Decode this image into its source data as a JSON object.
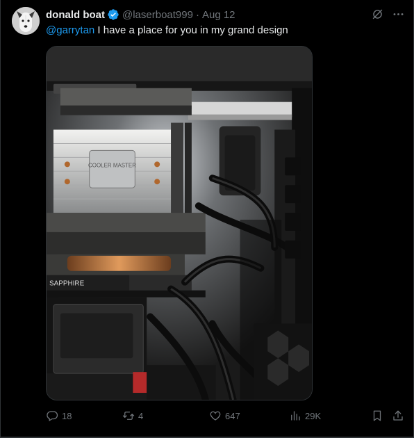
{
  "tweet": {
    "display_name": "donald boat",
    "handle": "@laserboat999",
    "separator": "·",
    "date": "Aug 12",
    "mention": "@garrytan",
    "text": " I have a place for you in my grand design"
  },
  "metrics": {
    "replies": "18",
    "reposts": "4",
    "likes": "647",
    "views": "29K"
  },
  "media": {
    "gpu_brand_text": "SAPPHIRE",
    "cooler_brand_text": "COOLER MASTER"
  },
  "icons": {
    "verified": "verified-badge-icon",
    "grok": "grok-icon",
    "more": "more-icon",
    "reply": "reply-icon",
    "repost": "repost-icon",
    "like": "heart-icon",
    "views": "views-icon",
    "bookmark": "bookmark-icon",
    "share": "share-icon"
  },
  "colors": {
    "background": "#000000",
    "text_primary": "#e7e9ea",
    "text_secondary": "#71767b",
    "accent": "#1d9bf0",
    "border": "#2f3336"
  }
}
